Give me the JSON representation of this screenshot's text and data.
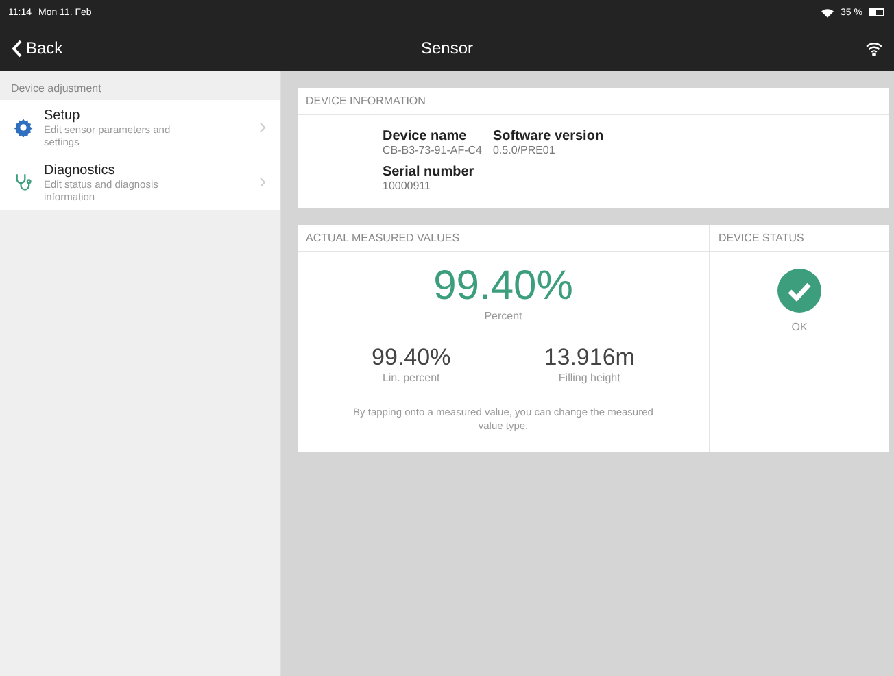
{
  "status_bar": {
    "time": "11:14",
    "date": "Mon 11. Feb",
    "battery": "35 %"
  },
  "nav": {
    "back": "Back",
    "title": "Sensor"
  },
  "sidebar": {
    "section": "Device adjustment",
    "items": [
      {
        "kind": "gear",
        "title": "Setup",
        "subtitle": "Edit sensor parameters and settings"
      },
      {
        "kind": "stethoscope",
        "title": "Diagnostics",
        "subtitle": "Edit status and diagnosis information"
      }
    ]
  },
  "device_information": {
    "title": "DEVICE INFORMATION",
    "fields": [
      {
        "label": "Device name",
        "value": "CB-B3-73-91-AF-C4"
      },
      {
        "label": "Software version",
        "value": "0.5.0/PRE01"
      },
      {
        "label": "Serial number",
        "value": "10000911"
      }
    ]
  },
  "measured_values": {
    "title": "ACTUAL MEASURED VALUES",
    "primary": {
      "value": "99.40%",
      "label": "Percent"
    },
    "secondary": [
      {
        "value": "99.40%",
        "label": "Lin. percent"
      },
      {
        "value": "13.916m",
        "label": "Filling height"
      }
    ],
    "hint": "By tapping onto a measured value, you can change the measured value type."
  },
  "device_status": {
    "title": "DEVICE STATUS",
    "kind": "ok",
    "label": "OK"
  }
}
